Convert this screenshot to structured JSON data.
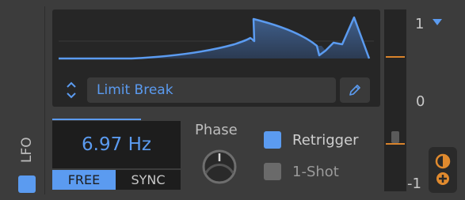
{
  "lfo": {
    "label": "LFO",
    "enabled": true
  },
  "preset": {
    "name": "Limit Break"
  },
  "frequency": {
    "value": "6.97 Hz",
    "mode_free": "FREE",
    "mode_sync": "SYNC",
    "active_mode": "FREE"
  },
  "phase": {
    "label": "Phase"
  },
  "options": {
    "retrigger": {
      "label": "Retrigger",
      "checked": true
    },
    "one_shot": {
      "label": "1-Shot",
      "checked": false
    }
  },
  "scale": {
    "top": "1",
    "mid": "0",
    "bottom": "-1"
  },
  "icons": {
    "stepper": "up-down-chevron-icon",
    "edit": "pencil-icon",
    "scale_dropdown": "dropdown-arrow-icon",
    "mod_top": "half-circle-icon",
    "mod_bottom": "plus-circle-icon"
  },
  "colors": {
    "accent": "#5b9bf0",
    "orange": "#d9832b",
    "background": "#3c3c3c",
    "panel": "#262626",
    "display": "#1d1d1d"
  }
}
